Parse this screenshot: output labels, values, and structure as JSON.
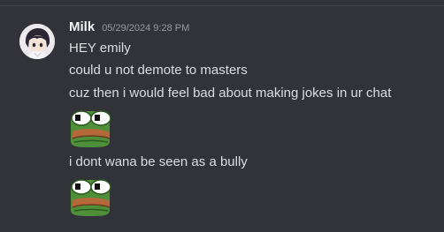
{
  "message": {
    "username": "Milk",
    "timestamp": "05/29/2024 9:28 PM",
    "lines": [
      "HEY emily",
      "could u not demote to masters",
      "cuz then i would feel bad about making jokes in ur chat",
      "i dont wana be seen as a bully"
    ],
    "emoji_name": "pepe-frog-emoji"
  },
  "colors": {
    "background": "#313338",
    "text": "#dbdee1",
    "username": "#f2f3f5",
    "timestamp": "#949ba4"
  }
}
